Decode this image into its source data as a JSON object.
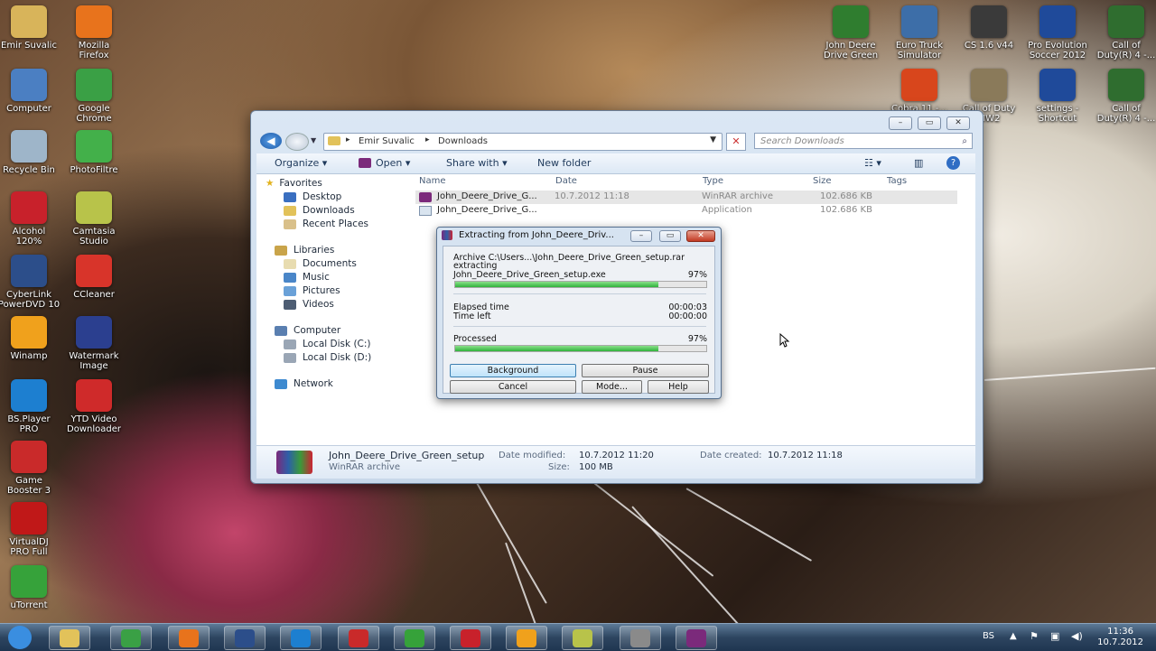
{
  "desktop_icons": [
    {
      "label": "Emir Suvalic",
      "icon": "user-folder-icon",
      "color": "#d8b45a"
    },
    {
      "label": "Mozilla\nFirefox",
      "icon": "firefox-icon",
      "color": "#e8731c"
    },
    {
      "label": "Computer",
      "icon": "computer-icon",
      "color": "#4b7fc2"
    },
    {
      "label": "Google\nChrome",
      "icon": "chrome-icon",
      "color": "#3aa045"
    },
    {
      "label": "Recycle Bin",
      "icon": "recycle-bin-icon",
      "color": "#9eb5c9"
    },
    {
      "label": "PhotoFiltre",
      "icon": "photofiltre-icon",
      "color": "#43b04a"
    },
    {
      "label": "Alcohol\n120%",
      "icon": "alcohol-icon",
      "color": "#c8212b"
    },
    {
      "label": "Camtasia\nStudio",
      "icon": "camtasia-icon",
      "color": "#b8c34a"
    },
    {
      "label": "CyberLink\nPowerDVD 10",
      "icon": "powerdvd-icon",
      "color": "#2c4e8a"
    },
    {
      "label": "CCleaner",
      "icon": "ccleaner-icon",
      "color": "#d8342a"
    },
    {
      "label": "Winamp",
      "icon": "winamp-icon",
      "color": "#f0a11c"
    },
    {
      "label": "Watermark\nImage",
      "icon": "watermark-icon",
      "color": "#2b3f8f"
    },
    {
      "label": "BS.Player\nPRO",
      "icon": "bsplayer-icon",
      "color": "#1d7fd0"
    },
    {
      "label": "YTD Video\nDownloader",
      "icon": "ytd-icon",
      "color": "#cf2a2a"
    },
    {
      "label": "Game\nBooster 3",
      "icon": "game-booster-icon",
      "color": "#c92a2a"
    },
    {
      "label": "VirtualDJ\nPRO Full",
      "icon": "virtualdj-icon",
      "color": "#c01818"
    },
    {
      "label": "uTorrent",
      "icon": "utorrent-icon",
      "color": "#36a23a"
    },
    {
      "label": "John Deere\nDrive Green",
      "icon": "drive-game-icon",
      "color": "#2f7d2f"
    },
    {
      "label": "Euro Truck\nSimulator",
      "icon": "euro-truck-icon",
      "color": "#3d6ea8"
    },
    {
      "label": "CS 1.6 v44",
      "icon": "counter-strike-icon",
      "color": "#3a3a3a"
    },
    {
      "label": "Pro Evolution\nSoccer 2012",
      "icon": "pes-icon",
      "color": "#1f4a9a"
    },
    {
      "label": "Call of\nDuty(R) 4 -...",
      "icon": "cod4-icon",
      "color": "#2f6d2f"
    },
    {
      "label": "Cobra 11 -...",
      "icon": "cobra11-icon",
      "color": "#d8461c"
    },
    {
      "label": "Call of Duty\nMW2",
      "icon": "mw2-icon",
      "color": "#8a7a5a"
    },
    {
      "label": "settings -\nShortcut",
      "icon": "pes-settings-icon",
      "color": "#1f4a9a"
    },
    {
      "label": "Call of\nDuty(R) 4 -...",
      "icon": "cod4-icon",
      "color": "#2f6d2f"
    }
  ],
  "explorer": {
    "breadcrumb": [
      "Emir Suvalic",
      "Downloads"
    ],
    "search_placeholder": "Search Downloads",
    "toolbar": {
      "organize": "Organize ▾",
      "open": "Open ▾",
      "share": "Share with ▾",
      "new_folder": "New folder"
    },
    "nav": {
      "favorites": "Favorites",
      "desktop": "Desktop",
      "downloads": "Downloads",
      "recent": "Recent Places",
      "libraries": "Libraries",
      "documents": "Documents",
      "music": "Music",
      "pictures": "Pictures",
      "videos": "Videos",
      "computer": "Computer",
      "disk_c": "Local Disk (C:)",
      "disk_d": "Local Disk (D:)",
      "network": "Network"
    },
    "columns": {
      "name": "Name",
      "date": "Date",
      "type": "Type",
      "size": "Size",
      "tags": "Tags"
    },
    "files": [
      {
        "name": "John_Deere_Drive_G...",
        "date": "10.7.2012 11:18",
        "type": "WinRAR archive",
        "size": "102.686 KB"
      },
      {
        "name": "John_Deere_Drive_G...",
        "date": "",
        "type": "Application",
        "size": "102.686 KB"
      }
    ],
    "details": {
      "name": "John_Deere_Drive_Green_setup",
      "type": "WinRAR archive",
      "modified_label": "Date modified:",
      "modified": "10.7.2012 11:20",
      "size_label": "Size:",
      "size": "100 MB",
      "created_label": "Date created:",
      "created": "10.7.2012 11:18"
    }
  },
  "rar_dialog": {
    "title": "Extracting from John_Deere_Driv...",
    "archive_line": "Archive C:\\Users...\\John_Deere_Drive_Green_setup.rar",
    "action": "extracting",
    "file": "John_Deere_Drive_Green_setup.exe",
    "file_pct": "97%",
    "file_progress": 0.81,
    "elapsed_label": "Elapsed time",
    "elapsed": "00:00:03",
    "left_label": "Time left",
    "left": "00:00:00",
    "processed_label": "Processed",
    "processed_pct": "97%",
    "processed_progress": 0.81,
    "buttons": {
      "background": "Background",
      "pause": "Pause",
      "cancel": "Cancel",
      "mode": "Mode...",
      "help": "Help"
    }
  },
  "taskbar": {
    "apps": [
      {
        "icon": "start-orb-icon",
        "color": "#3a8ee0"
      },
      {
        "icon": "explorer-folder-icon",
        "color": "#e2c25a"
      },
      {
        "icon": "chrome-icon",
        "color": "#3aa045"
      },
      {
        "icon": "firefox-icon",
        "color": "#e8731c"
      },
      {
        "icon": "powerdvd-icon",
        "color": "#2c4e8a"
      },
      {
        "icon": "bsplayer-icon",
        "color": "#1d7fd0"
      },
      {
        "icon": "game-booster-icon",
        "color": "#c92a2a"
      },
      {
        "icon": "utorrent-icon",
        "color": "#36a23a"
      },
      {
        "icon": "alcohol-icon",
        "color": "#c8212b"
      },
      {
        "icon": "winamp-icon",
        "color": "#f0a11c"
      },
      {
        "icon": "camtasia-icon",
        "color": "#b8c34a"
      },
      {
        "icon": "ytd-icon",
        "color": "#8a8a8a"
      },
      {
        "icon": "winrar-icon",
        "color": "#7b2a7b"
      }
    ],
    "lang": "BS",
    "time": "11:36",
    "date": "10.7.2012"
  }
}
